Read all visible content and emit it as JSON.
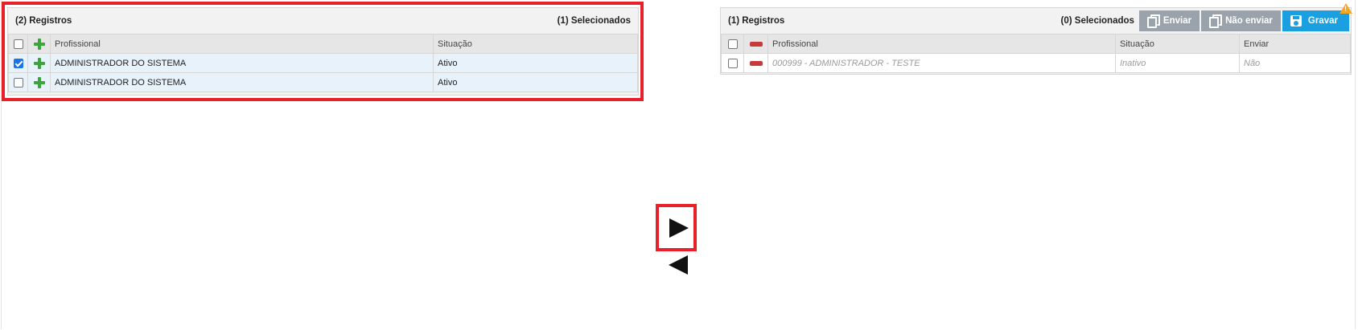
{
  "left_panel": {
    "count_label": "(2) Registros",
    "selected_label": "(1) Selecionados",
    "columns": {
      "professional": "Profissional",
      "status": "Situação"
    },
    "rows": [
      {
        "checked": true,
        "name": "ADMINISTRADOR DO SISTEMA",
        "status": "Ativo"
      },
      {
        "checked": false,
        "name": "ADMINISTRADOR DO SISTEMA",
        "status": "Ativo"
      }
    ]
  },
  "right_panel": {
    "count_label": "(1) Registros",
    "selected_label": "(0) Selecionados",
    "buttons": {
      "send": "Enviar",
      "not_send": "Não enviar",
      "save": "Gravar",
      "save_warning": "!"
    },
    "columns": {
      "professional": "Profissional",
      "status": "Situação",
      "send": "Enviar"
    },
    "rows": [
      {
        "checked": false,
        "name": "000999 - ADMINISTRADOR - TESTE",
        "status": "Inativo",
        "send": "Não"
      }
    ]
  },
  "icons": {
    "add": "plus-icon",
    "remove": "minus-icon",
    "move_right": "arrow-right-icon",
    "move_left": "arrow-left-icon"
  },
  "colors": {
    "highlight": "#e8202a",
    "primary_button": "#1aa0e0",
    "secondary_button": "#9aa3ab",
    "add_icon": "#3ba53b",
    "remove_icon": "#c83a3a"
  }
}
